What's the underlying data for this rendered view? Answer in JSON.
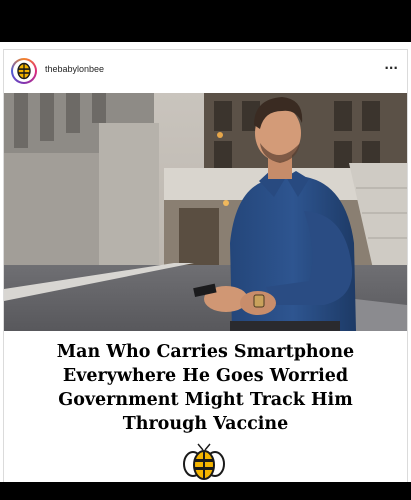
{
  "post": {
    "username": "thebabylonbee",
    "more_icon": "more-horizontal-icon",
    "headline_lines": [
      "Man Who Carries Smartphone",
      "Everywhere He Goes Worried",
      "Government Might Track Him",
      "Through Vaccine"
    ],
    "photo_icon": "photo-man-with-phone",
    "logo_icon": "babylon-bee-logo-icon"
  },
  "colors": {
    "background": "#000000",
    "card": "#ffffff",
    "bee_yellow": "#f4b400",
    "text": "#000000"
  }
}
